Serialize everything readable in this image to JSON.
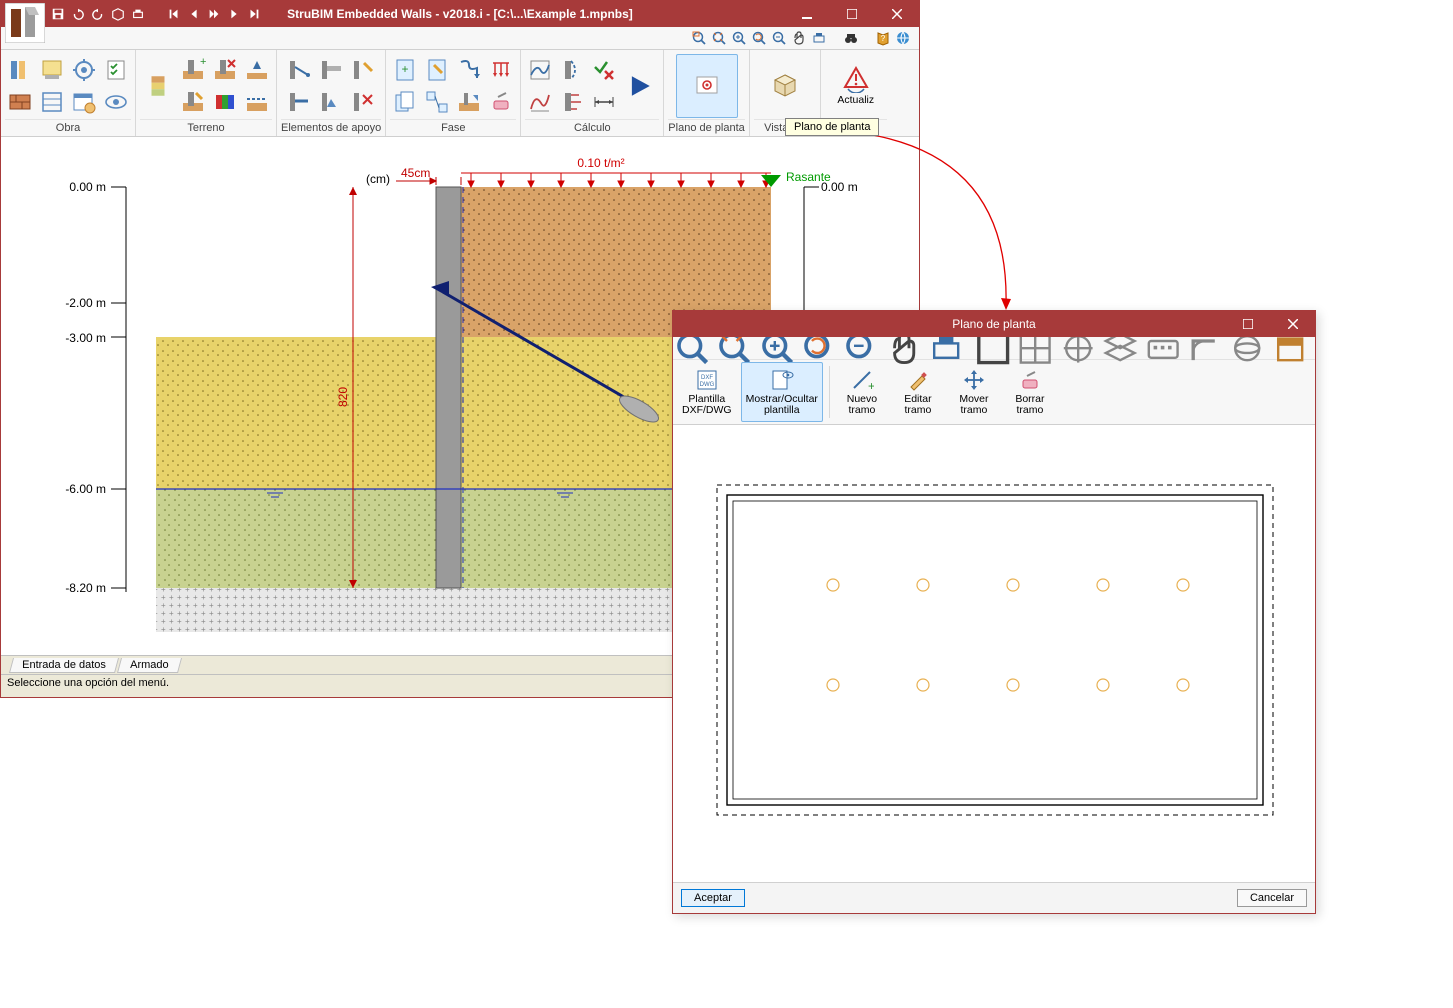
{
  "main": {
    "title": "StruBIM Embedded Walls - v2018.i - [C:\\...\\Example 1.mpnbs]",
    "ribbon_groups": {
      "obra": "Obra",
      "terreno": "Terreno",
      "elementos": "Elementos de apoyo",
      "fase": "Fase",
      "calculo": "Cálculo",
      "plano_planta": "Plano de planta",
      "vista3d": "Vista 3D",
      "actualizar": "Actualiz"
    },
    "tooltip": "Plano de planta",
    "drawing": {
      "scale_unit_label": "(cm)",
      "wall_width_label": "45cm",
      "load_label": "0.10 t/m²",
      "rasante_label": "Rasante",
      "depth_label": "820",
      "left_ticks": [
        "0.00 m",
        "-2.00 m",
        "-3.00 m",
        "-6.00 m",
        "-8.20 m"
      ],
      "right_tick": "0.00 m"
    },
    "tabs": {
      "entrada": "Entrada de datos",
      "armado": "Armado"
    },
    "status": "Seleccione una opción del menú."
  },
  "dialog": {
    "title": "Plano de planta",
    "buttons": {
      "plantilla": "Plantilla\nDXF/DWG",
      "mostrar": "Mostrar/Ocultar\nplantilla",
      "nuevo": "Nuevo\ntramo",
      "editar": "Editar\ntramo",
      "mover": "Mover\ntramo",
      "borrar": "Borrar\ntramo"
    },
    "accept": "Aceptar",
    "cancel": "Cancelar"
  },
  "colors": {
    "brand": "#a73a3a",
    "highlight": "#dbeeff"
  }
}
